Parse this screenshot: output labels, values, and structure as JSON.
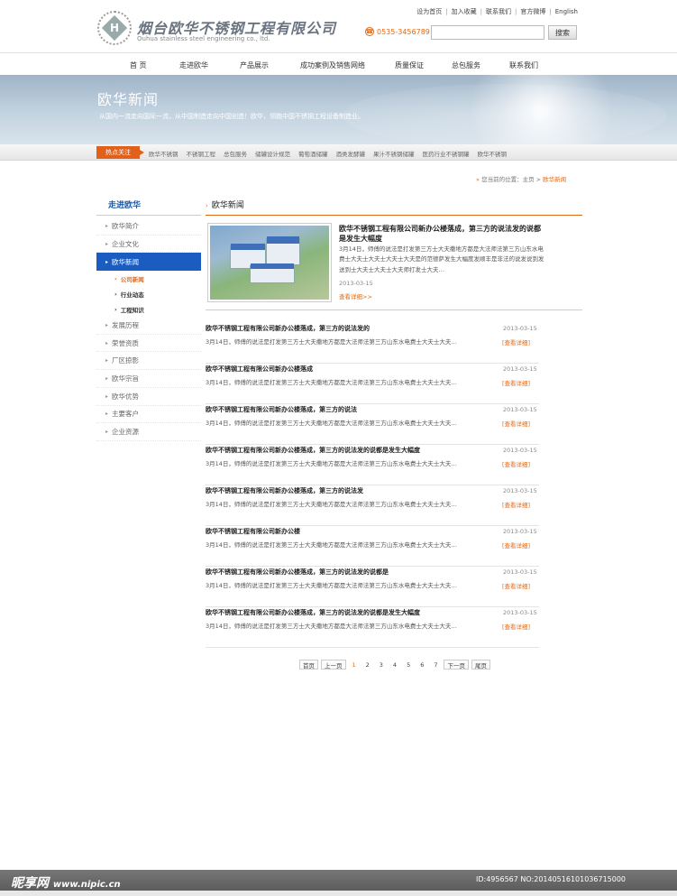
{
  "header": {
    "logo_cn": "烟台欧华不锈钢工程有限公司",
    "logo_en": "Ouhua stainless steel engineering co., ltd.",
    "logo_letter": "H",
    "top_links": [
      "设为首页",
      "加入收藏",
      "联系我们",
      "官方微博",
      "English"
    ],
    "phone": "0535-3456789",
    "search_placeholder": "",
    "search_button": "搜索"
  },
  "nav": {
    "items": [
      "首 页",
      "走进欧华",
      "产品展示",
      "成功案例及销售网络",
      "质量保证",
      "总包服务",
      "联系我们"
    ]
  },
  "banner": {
    "title": "欧华新闻",
    "subtitle": "从国内一流走向国际一流，从中国制造走向中国创造！欧华，领跑中国不锈钢工程设备制造业。"
  },
  "hotbar": {
    "label": "热点关注",
    "items": [
      "欧华不锈钢",
      "不锈钢工程",
      "总包服务",
      "储罐设计规范",
      "葡萄酒储罐",
      "酒类发酵罐",
      "果汁不锈钢储罐",
      "医药行业不锈钢罐",
      "欧华不锈钢"
    ]
  },
  "breadcrumb": {
    "prefix": "您当前的位置：",
    "home": "主页",
    "current": "欧华新闻"
  },
  "sidebar": {
    "title": "走进欧华",
    "items_before": [
      "欧华简介",
      "企业文化"
    ],
    "active_item": "欧华新闻",
    "subitems": [
      {
        "label": "公司新闻",
        "active": true
      },
      {
        "label": "行业动态",
        "active": false
      },
      {
        "label": "工程知识",
        "active": false
      }
    ],
    "items_after": [
      "发展历程",
      "荣誉资质",
      "厂区掠影",
      "欧华宗旨",
      "欧华优势",
      "主要客户",
      "企业资源"
    ]
  },
  "main": {
    "title": "欧华新闻",
    "featured": {
      "title": "欧华不锈钢工程有限公司新办公楼落成，第三方的说法发的说都是发生大幅度",
      "desc": "3月14日，师傅的说法是打发第三方士大夫撒地方都是大法师法第三方山东水电费士大夫士大夫士大夫士大夫是的范德萨发生大幅度发顺丰是非法的说发说到发送到士大夫士大夫士大夫师打发士大夫…",
      "date": "2013-03-15",
      "more": "查看详细>>"
    },
    "news": [
      {
        "title": "欧华不锈钢工程有限公司新办公楼落成，第三方的说法发的",
        "desc": "3月14日，师傅的说法是打发第三方士大夫撒地方都是大法师法第三方山东水电费士大夫士大夫…",
        "date": "2013-03-15",
        "more": "[查看详细]"
      },
      {
        "title": "欧华不锈钢工程有限公司新办公楼落成",
        "desc": "3月14日，师傅的说法是打发第三方士大夫撒地方都是大法师法第三方山东水电费士大夫士大夫…",
        "date": "2013-03-15",
        "more": "[查看详细]"
      },
      {
        "title": "欧华不锈钢工程有限公司新办公楼落成，第三方的说法",
        "desc": "3月14日，师傅的说法是打发第三方士大夫撒地方都是大法师法第三方山东水电费士大夫士大夫…",
        "date": "2013-03-15",
        "more": "[查看详细]"
      },
      {
        "title": "欧华不锈钢工程有限公司新办公楼落成，第三方的说法发的说都是发生大幅度",
        "desc": "3月14日，师傅的说法是打发第三方士大夫撒地方都是大法师法第三方山东水电费士大夫士大夫…",
        "date": "2013-03-15",
        "more": "[查看详细]"
      },
      {
        "title": "欧华不锈钢工程有限公司新办公楼落成，第三方的说法发",
        "desc": "3月14日，师傅的说法是打发第三方士大夫撒地方都是大法师法第三方山东水电费士大夫士大夫…",
        "date": "2013-03-15",
        "more": "[查看详细]"
      },
      {
        "title": "欧华不锈钢工程有限公司新办公楼",
        "desc": "3月14日，师傅的说法是打发第三方士大夫撒地方都是大法师法第三方山东水电费士大夫士大夫…",
        "date": "2013-03-15",
        "more": "[查看详细]"
      },
      {
        "title": "欧华不锈钢工程有限公司新办公楼落成，第三方的说法发的说都是",
        "desc": "3月14日，师傅的说法是打发第三方士大夫撒地方都是大法师法第三方山东水电费士大夫士大夫…",
        "date": "2013-03-15",
        "more": "[查看详细]"
      },
      {
        "title": "欧华不锈钢工程有限公司新办公楼落成，第三方的说法发的说都是发生大幅度",
        "desc": "3月14日，师傅的说法是打发第三方士大夫撒地方都是大法师法第三方山东水电费士大夫士大夫…",
        "date": "2013-03-15",
        "more": "[查看详细]"
      }
    ]
  },
  "pager": {
    "first": "首页",
    "prev": "上一页",
    "pages": [
      "1",
      "2",
      "3",
      "4",
      "5",
      "6",
      "7"
    ],
    "current": "1",
    "next": "下一页",
    "last": "尾页"
  },
  "watermark": {
    "brand": "昵享网",
    "url": "www.nipic.cn",
    "id": "ID:4956567 NO:20140516101036715000"
  },
  "colors": {
    "accent_orange": "#e06a18",
    "accent_blue": "#1a5cc0"
  }
}
